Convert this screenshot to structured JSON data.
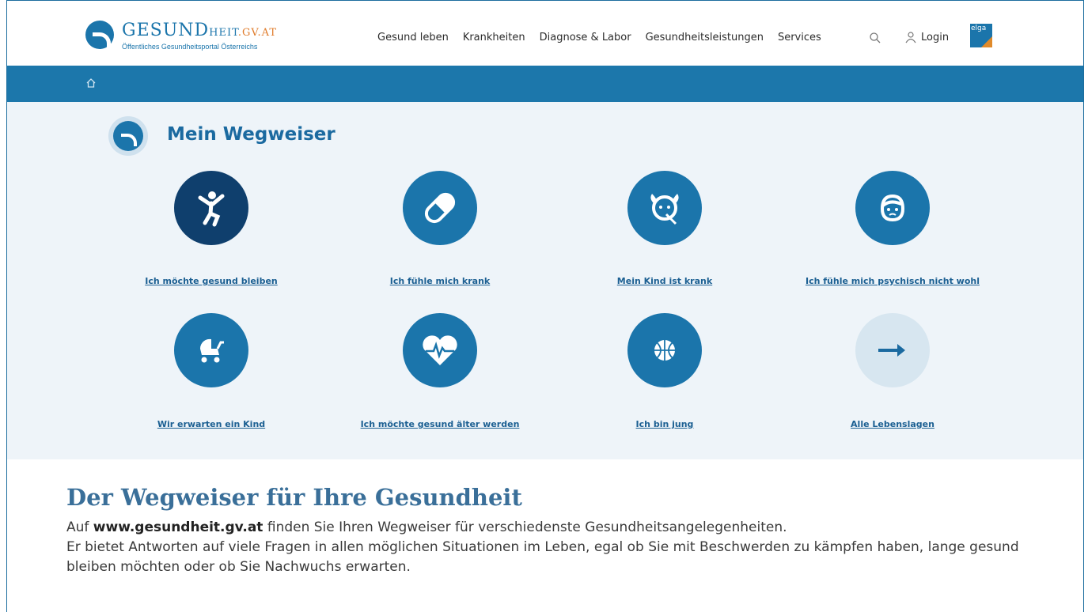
{
  "header": {
    "logo_title_big": "GESUND",
    "logo_title_small": "HEIT",
    "logo_domain": ".GV.AT",
    "logo_subtitle": "Öffentliches Gesundheitsportal Österreichs",
    "nav_items": [
      "Gesund leben",
      "Krankheiten",
      "Diagnose & Labor",
      "Gesundheitsleistungen",
      "Services"
    ],
    "login_label": "Login",
    "elga_label": "elga"
  },
  "main": {
    "title": "Mein Wegweiser",
    "tiles": [
      {
        "label": "Ich möchte gesund bleiben",
        "icon": "dancer-icon"
      },
      {
        "label": "Ich fühle mich krank",
        "icon": "pill-icon"
      },
      {
        "label": "Mein Kind ist krank",
        "icon": "child-face-icon"
      },
      {
        "label": "Ich fühle mich psychisch nicht wohl",
        "icon": "face-icon"
      },
      {
        "label": "Wir erwarten ein Kind",
        "icon": "pram-icon"
      },
      {
        "label": "Ich möchte gesund älter werden",
        "icon": "heartbeat-icon"
      },
      {
        "label": "Ich bin jung",
        "icon": "basketball-icon"
      },
      {
        "label": "Alle Lebenslagen",
        "icon": "arrow-right-icon"
      }
    ]
  },
  "text": {
    "heading": "Der Wegweiser für Ihre Gesundheit",
    "para_prefix": "Auf",
    "para_link": "www.gesundheit.gv.at",
    "para_rest": "finden Sie Ihren Wegweiser für verschiedenste Gesundheitsangelegenheiten.",
    "para_line2": "Er bietet Antworten auf viele Fragen in allen möglichen Situationen im Leben, egal ob Sie mit Beschwerden zu kämpfen haben, lange gesund bleiben möchten oder ob Sie Nachwuchs erwarten."
  },
  "colors": {
    "brand_blue": "#1b75ab",
    "dark_blue": "#0f3f6d",
    "panel_bg": "#eef4f9",
    "accent_orange": "#e08a2a"
  }
}
